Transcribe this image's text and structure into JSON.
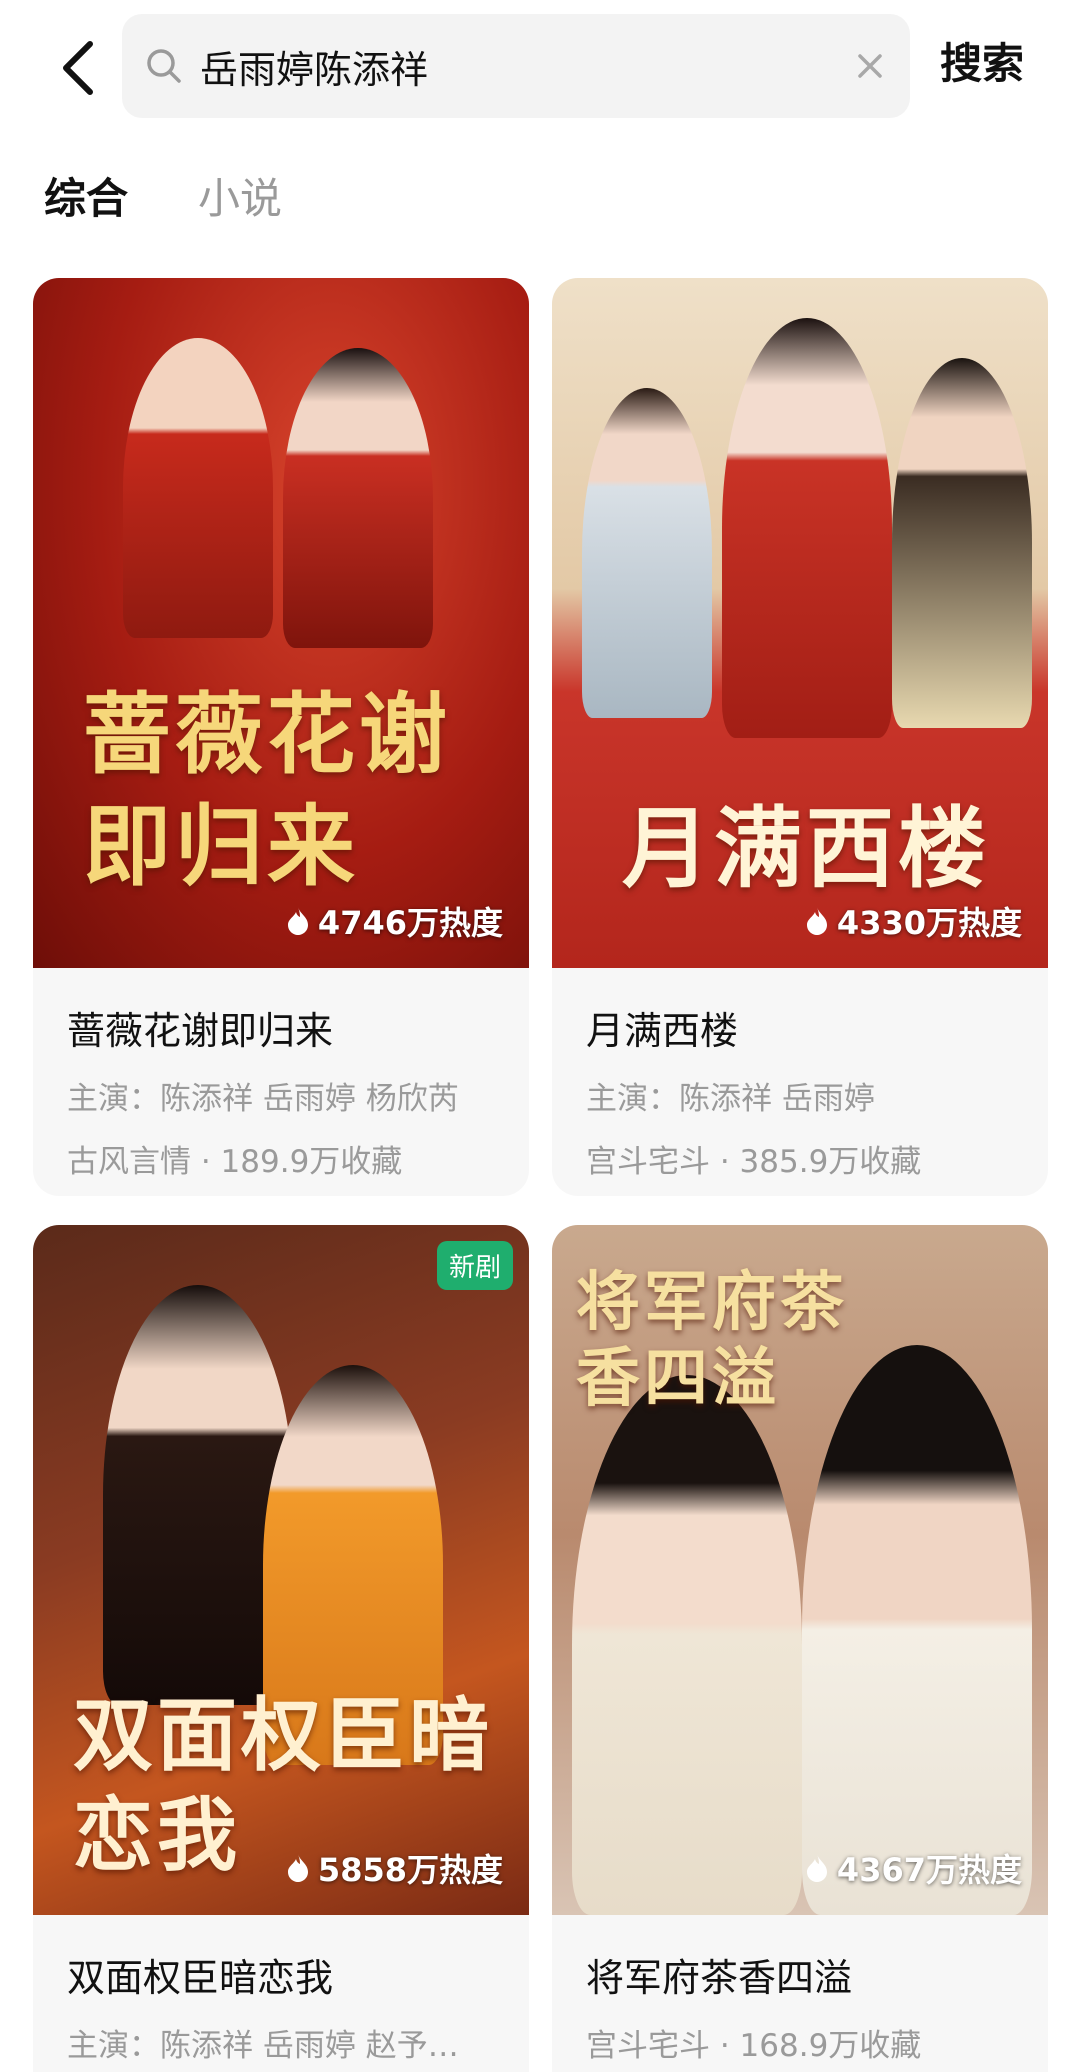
{
  "search": {
    "query": "岳雨婷陈添祥",
    "button_label": "搜索"
  },
  "tabs": [
    {
      "label": "综合",
      "active": true
    },
    {
      "label": "小说",
      "active": false
    }
  ],
  "colors": {
    "accent_green": "#1fae6e",
    "meta_gray": "#9a9a9a",
    "card_bg": "#f7f7f7"
  },
  "results": [
    {
      "title": "蔷薇花谢即归来",
      "poster_title": "蔷薇花谢即归来",
      "heat": "4746万热度",
      "cast": "主演：陈添祥 岳雨婷 杨欣芮",
      "tags": "古风言情 · 189.9万收藏",
      "badge": ""
    },
    {
      "title": "月满西楼",
      "poster_title": "月满西楼",
      "heat": "4330万热度",
      "cast": "主演：陈添祥 岳雨婷",
      "tags": "宫斗宅斗 · 385.9万收藏",
      "badge": ""
    },
    {
      "title": "双面权臣暗恋我",
      "poster_title": "双面权臣暗恋我",
      "heat": "5858万热度",
      "cast": "主演：陈添祥 岳雨婷 赵予…",
      "tags": "",
      "badge": "新剧"
    },
    {
      "title": "将军府茶香四溢",
      "poster_title": "将军府茶香四溢",
      "heat": "4367万热度",
      "cast": "宫斗宅斗 · 168.9万收藏",
      "tags": "",
      "badge": ""
    }
  ]
}
